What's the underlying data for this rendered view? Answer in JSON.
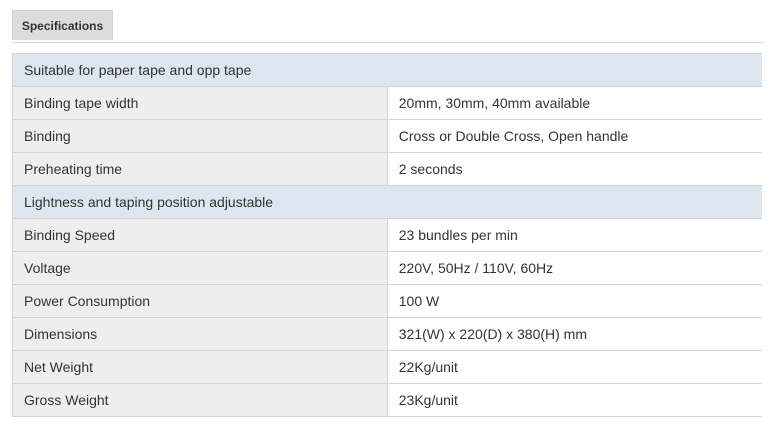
{
  "tabs": {
    "active_label": "Specifications"
  },
  "specs": {
    "section_1": "Suitable for paper tape and opp tape",
    "rows_a": [
      {
        "label": "Binding tape width",
        "value": "20mm, 30mm, 40mm available"
      },
      {
        "label": "Binding",
        "value": "Cross or Double Cross, Open handle"
      },
      {
        "label": "Preheating time",
        "value": "2 seconds"
      }
    ],
    "section_2": "Lightness and taping position adjustable",
    "rows_b": [
      {
        "label": "Binding Speed",
        "value": "23 bundles per min"
      },
      {
        "label": "Voltage",
        "value": "220V, 50Hz / 110V, 60Hz"
      },
      {
        "label": "Power Consumption",
        "value": "100 W"
      },
      {
        "label": "Dimensions",
        "value": "321(W) x 220(D) x 380(H) mm"
      },
      {
        "label": "Net Weight",
        "value": "22Kg/unit"
      },
      {
        "label": "Gross Weight",
        "value": "23Kg/unit"
      }
    ]
  }
}
